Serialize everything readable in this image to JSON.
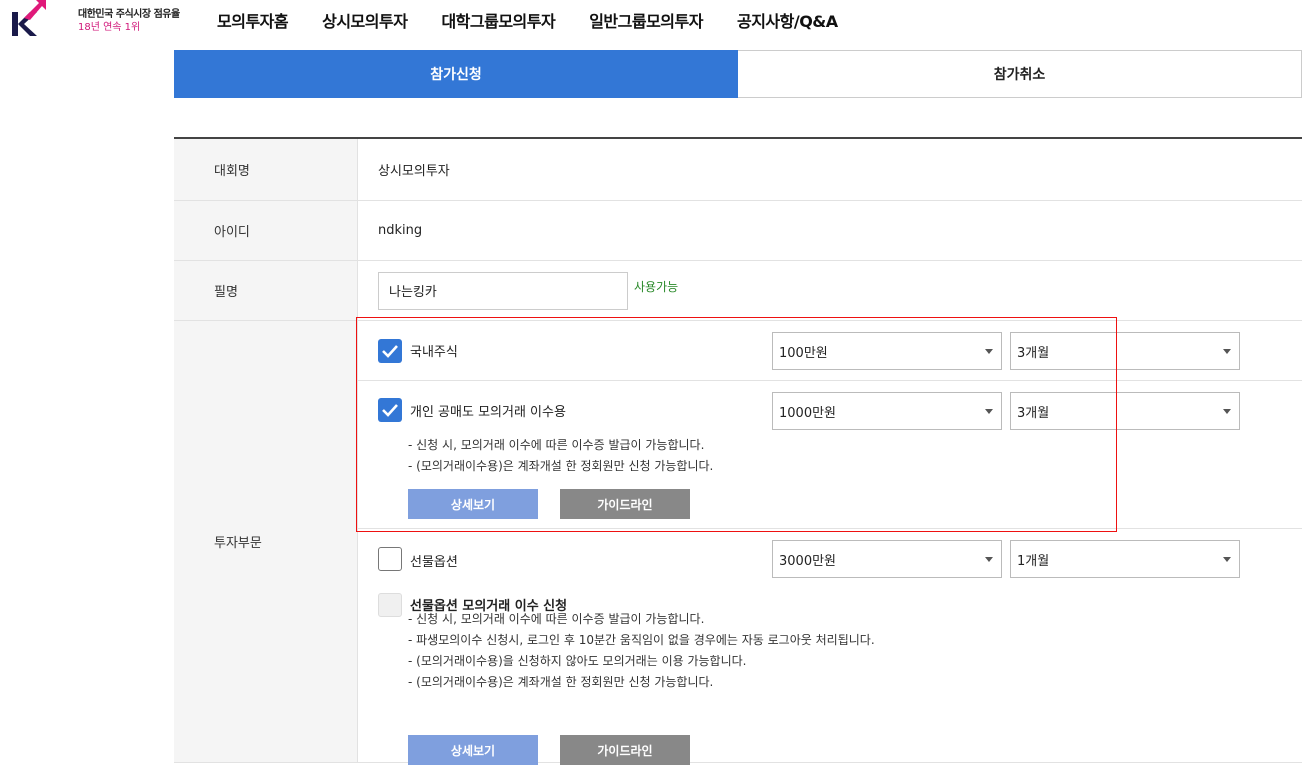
{
  "header": {
    "logo_letter": "K",
    "tagline_line1": "대한민국 주식시장 점유율",
    "tagline_line2": "18년 연속 1위",
    "nav": [
      "모의투자홈",
      "상시모의투자",
      "대학그룹모의투자",
      "일반그룹모의투자",
      "공지사항/Q&A"
    ],
    "brand_color": "#d1177a"
  },
  "tabs": {
    "apply": "참가신청",
    "cancel": "참가취소",
    "active_color": "#3377d6"
  },
  "form": {
    "contest_label": "대회명",
    "contest_value": "상시모의투자",
    "id_label": "아이디",
    "id_value": "ndking",
    "nickname_label": "필명",
    "nickname_value": "나는킹카",
    "nickname_status": "사용가능",
    "invest_label": "투자부문",
    "sections": [
      {
        "label": "국내주식",
        "checked": true,
        "amount": "100만원",
        "period": "3개월"
      },
      {
        "label": "개인 공매도 모의거래 이수용",
        "checked": true,
        "amount": "1000만원",
        "period": "3개월",
        "notes": [
          "- 신청 시, 모의거래 이수에 따른 이수증 발급이 가능합니다.",
          "- (모의거래이수용)은 계좌개설 한 정회원만 신청 가능합니다."
        ],
        "detail_button": "상세보기",
        "guide_button": "가이드라인"
      },
      {
        "label": "선물옵션",
        "checked": false,
        "amount": "3000만원",
        "period": "1개월"
      },
      {
        "label": "선물옵션 모의거래 이수 신청",
        "checked": false,
        "disabled": true,
        "notes": [
          "- 신청 시, 모의거래 이수에 따른 이수증 발급이 가능합니다.",
          "- 파생모의이수 신청시, 로그인 후 10분간 움직임이 없을 경우에는 자동 로그아웃 처리됩니다.",
          "- (모의거래이수용)을 신청하지 않아도 모의거래는 이용 가능합니다.",
          "- (모의거래이수용)은 계좌개설 한 정회원만 신청 가능합니다."
        ],
        "detail_button": "상세보기",
        "guide_button": "가이드라인"
      }
    ]
  }
}
